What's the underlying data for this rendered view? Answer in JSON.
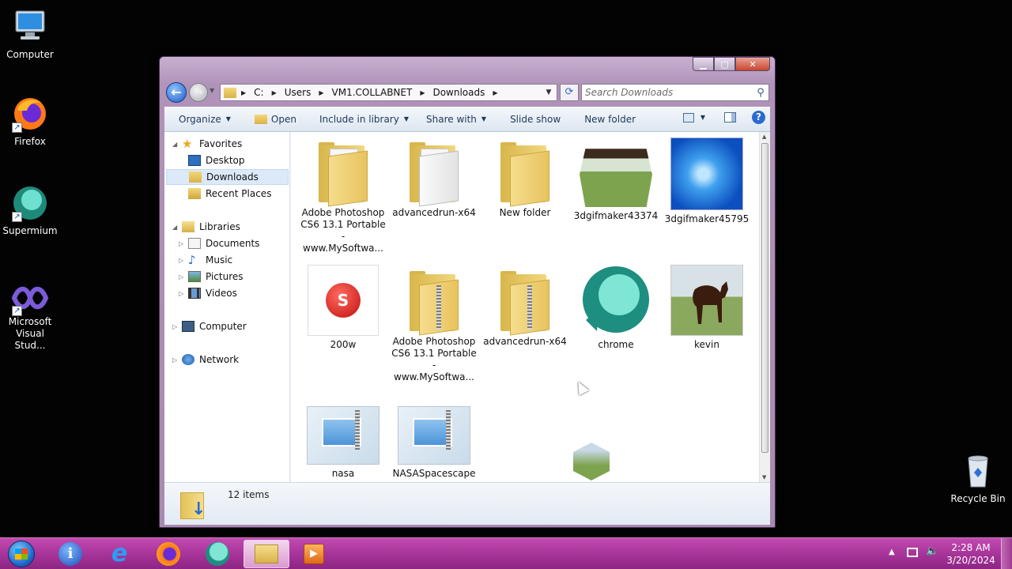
{
  "desktop": {
    "icons": [
      {
        "label": "Computer",
        "icon": "computer-icon"
      },
      {
        "label": "Firefox",
        "icon": "firefox-icon"
      },
      {
        "label": "Supermium",
        "icon": "supermium-icon"
      },
      {
        "label": "Microsoft Visual Stud...",
        "icon": "visual-studio-icon"
      },
      {
        "label": "Recycle Bin",
        "icon": "recycle-bin-icon"
      }
    ]
  },
  "window": {
    "caption_buttons": {
      "minimize": "▁",
      "maximize": "▢",
      "close": "✕"
    },
    "nav": {
      "back": "←",
      "forward": "→"
    },
    "address": {
      "crumbs": [
        "C:",
        "Users",
        "VM1.COLLABNET",
        "Downloads"
      ]
    },
    "search": {
      "placeholder": "Search Downloads"
    },
    "toolbar": {
      "organize": "Organize",
      "open": "Open",
      "include_in_library": "Include in library",
      "share_with": "Share with",
      "slide_show": "Slide show",
      "new_folder": "New folder"
    },
    "nav_pane": {
      "favorites": "Favorites",
      "desktop": "Desktop",
      "downloads": "Downloads",
      "recent_places": "Recent Places",
      "libraries": "Libraries",
      "documents": "Documents",
      "music": "Music",
      "pictures": "Pictures",
      "videos": "Videos",
      "computer": "Computer",
      "network": "Network"
    },
    "files": [
      "Adobe Photoshop CS6 13.1 Portable - www.MySoftwa...",
      "advancedrun-x64",
      "New folder",
      "3dgifmaker43374",
      "3dgifmaker45795",
      "200w",
      "Adobe Photoshop CS6 13.1 Portable - www.MySoftwa...",
      "advancedrun-x64",
      "chrome",
      "kevin",
      "nasa",
      "NASASpacescape"
    ],
    "details": {
      "item_count": "12 items"
    }
  },
  "taskbar": {
    "clock": {
      "time": "2:28 AM",
      "date": "3/20/2024"
    }
  },
  "colors": {
    "taskbar": "#a8359a",
    "accent": "#2a6bd1"
  }
}
